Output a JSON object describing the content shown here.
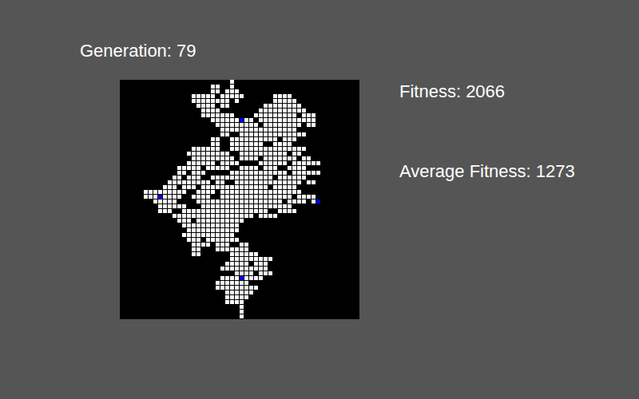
{
  "generation": {
    "label": "Generation: 79"
  },
  "stats": [
    {
      "label": "Fitness: 2066"
    },
    {
      "label": "Average Fitness: 1273"
    }
  ],
  "grid": {
    "rows": [
      [
        [
          23,
          23
        ]
      ],
      [
        [
          19,
          20
        ],
        [
          23,
          23
        ]
      ],
      [
        [
          19,
          20
        ],
        [
          22,
          24
        ]
      ],
      [
        [
          15,
          19
        ],
        [
          21,
          25
        ],
        [
          32,
          35
        ]
      ],
      [
        [
          15,
          22
        ],
        [
          24,
          24
        ],
        [
          32,
          36
        ]
      ],
      [
        [
          16,
          19
        ],
        [
          21,
          22
        ],
        [
          30,
          37
        ]
      ],
      [
        [
          17,
          20
        ],
        [
          29,
          38
        ]
      ],
      [
        [
          17,
          23
        ],
        [
          28,
          36
        ],
        [
          38,
          40
        ]
      ],
      [
        [
          19,
          27
        ],
        [
          29,
          40
        ]
      ],
      [
        [
          20,
          28
        ],
        [
          30,
          37
        ],
        [
          39,
          40
        ]
      ],
      [
        [
          21,
          36
        ]
      ],
      [
        [
          21,
          22
        ],
        [
          25,
          38
        ]
      ],
      [
        [
          19,
          20
        ],
        [
          23,
          32
        ],
        [
          34,
          36
        ]
      ],
      [
        [
          19,
          20
        ],
        [
          23,
          29
        ],
        [
          32,
          35
        ]
      ],
      [
        [
          15,
          20
        ],
        [
          23,
          38
        ]
      ],
      [
        [
          14,
          22
        ],
        [
          25,
          34
        ],
        [
          36,
          37
        ]
      ],
      [
        [
          15,
          23
        ],
        [
          25,
          28
        ],
        [
          30,
          36
        ],
        [
          38,
          39
        ]
      ],
      [
        [
          14,
          19
        ],
        [
          21,
          24
        ],
        [
          29,
          34
        ],
        [
          36,
          41
        ]
      ],
      [
        [
          12,
          16
        ],
        [
          18,
          22
        ],
        [
          25,
          28
        ],
        [
          30,
          32
        ],
        [
          35,
          38
        ]
      ],
      [
        [
          12,
          13
        ],
        [
          15,
          17
        ],
        [
          23,
          34
        ],
        [
          36,
          41
        ]
      ],
      [
        [
          11,
          12
        ],
        [
          14,
          16
        ],
        [
          19,
          31
        ],
        [
          33,
          38
        ]
      ],
      [
        [
          10,
          18
        ],
        [
          20,
          21
        ],
        [
          24,
          37
        ],
        [
          39,
          40
        ]
      ],
      [
        [
          9,
          11
        ],
        [
          13,
          15
        ],
        [
          17,
          30
        ],
        [
          32,
          36
        ]
      ],
      [
        [
          5,
          13
        ],
        [
          16,
          19
        ],
        [
          21,
          37
        ]
      ],
      [
        [
          5,
          12
        ],
        [
          15,
          18
        ],
        [
          21,
          35
        ],
        [
          37,
          40
        ]
      ],
      [
        [
          7,
          11
        ],
        [
          16,
          33
        ],
        [
          35,
          38
        ],
        [
          40,
          41
        ]
      ],
      [
        [
          8,
          13
        ],
        [
          17,
          35
        ]
      ],
      [
        [
          8,
          10
        ],
        [
          13,
          30
        ],
        [
          33,
          36
        ]
      ],
      [
        [
          11,
          27
        ],
        [
          29,
          32
        ]
      ],
      [
        [
          12,
          14
        ],
        [
          16,
          25
        ]
      ],
      [
        [
          13,
          24
        ]
      ],
      [
        [
          14,
          24
        ]
      ],
      [
        [
          13,
          23
        ]
      ],
      [
        [
          14,
          16
        ],
        [
          18,
          24
        ]
      ],
      [
        [
          15,
          18
        ],
        [
          20,
          22
        ],
        [
          25,
          26
        ]
      ],
      [
        [
          15,
          16
        ],
        [
          20,
          26
        ]
      ],
      [
        [
          15,
          16
        ],
        [
          23,
          28
        ]
      ],
      [
        [
          23,
          31
        ]
      ],
      [
        [
          22,
          26
        ],
        [
          28,
          30
        ]
      ],
      [
        [
          21,
          30
        ]
      ],
      [
        [
          24,
          27
        ],
        [
          29,
          31
        ]
      ],
      [
        [
          21,
          29
        ]
      ],
      [
        [
          20,
          26
        ]
      ],
      [
        [
          20,
          28
        ]
      ],
      [
        [
          22,
          27
        ]
      ],
      [
        [
          22,
          26
        ]
      ],
      [
        [
          22,
          25
        ]
      ],
      [
        [
          25,
          25
        ]
      ],
      [
        [
          25,
          25
        ]
      ],
      [
        [
          25,
          25
        ]
      ]
    ],
    "highlighted": [
      [
        8,
        25
      ],
      [
        24,
        8
      ],
      [
        25,
        41
      ],
      [
        41,
        25
      ]
    ]
  }
}
